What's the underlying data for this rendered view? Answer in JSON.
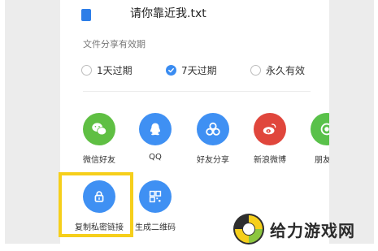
{
  "file": {
    "name": "请你靠近我.txt"
  },
  "validity": {
    "title": "文件分享有效期",
    "options": [
      {
        "label": "1天过期",
        "selected": false
      },
      {
        "label": "7天过期",
        "selected": true
      },
      {
        "label": "永久有效",
        "selected": false
      }
    ]
  },
  "share_row1": [
    {
      "label": "微信好友",
      "icon": "wechat-icon",
      "color": "#5fbf43"
    },
    {
      "label": "QQ",
      "icon": "qq-icon",
      "color": "#3f90f3"
    },
    {
      "label": "好友分享",
      "icon": "friends-share-icon",
      "color": "#3f90f3"
    },
    {
      "label": "新浪微博",
      "icon": "weibo-icon",
      "color": "#e0463c"
    },
    {
      "label": "朋友圈",
      "icon": "moments-icon",
      "color": "#59c14a"
    }
  ],
  "share_row2": [
    {
      "label": "复制私密链接",
      "icon": "lock-icon",
      "color": "#3f90f3"
    },
    {
      "label": "生成二维码",
      "icon": "qrcode-icon",
      "color": "#3f90f3"
    }
  ],
  "watermark": {
    "text": "给力游戏网"
  },
  "colors": {
    "accent": "#3a8cf1",
    "highlight": "#f6cf1b"
  }
}
